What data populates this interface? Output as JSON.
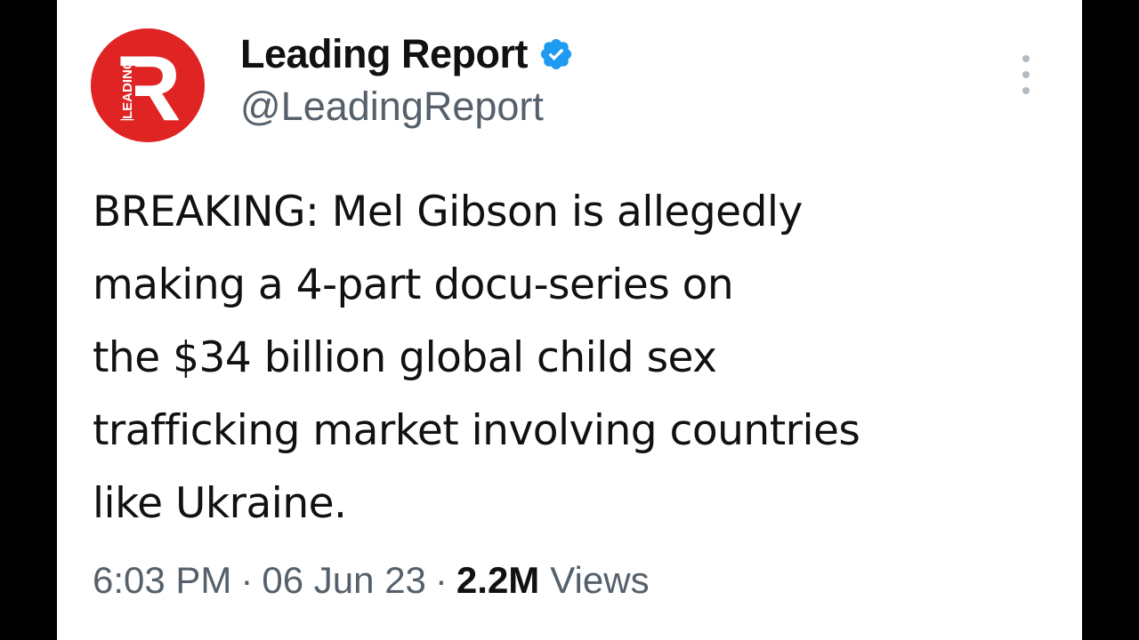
{
  "tweet": {
    "author": {
      "display_name": "Leading Report",
      "handle": "@LeadingReport",
      "avatar_letter": "R",
      "avatar_vertical_text": "LEADING",
      "avatar_color": "#e02424",
      "verified_icon": "verified-badge-icon",
      "verified_color": "#1d9bf0"
    },
    "text_lines": [
      "BREAKING: Mel Gibson is allegedly",
      "making a 4-part docu-series on",
      "the $34 billion global child sex",
      "trafficking market involving countries",
      "like Ukraine."
    ],
    "meta": {
      "time": "6:03 PM",
      "separator": "·",
      "date": "06 Jun 23",
      "views_count": "2.2M",
      "views_label": "Views"
    },
    "more_icon": "more-vertical-icon"
  }
}
